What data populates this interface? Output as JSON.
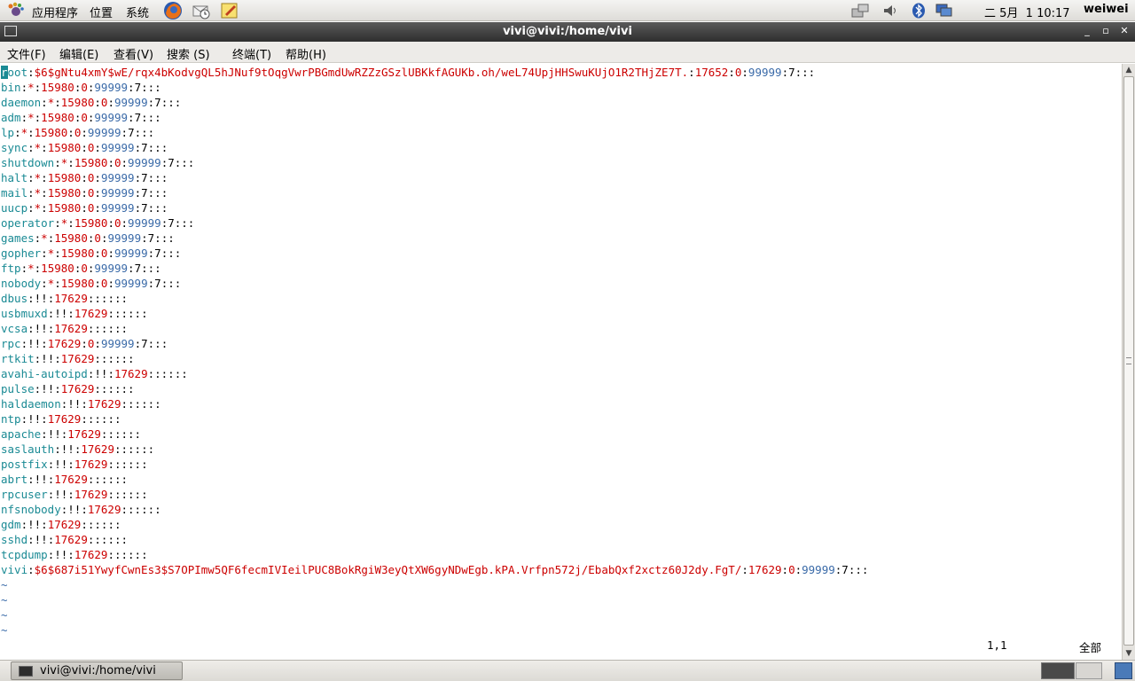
{
  "top_panel": {
    "menus": [
      "应用程序",
      "位置",
      "系统"
    ],
    "clock": "二 5月  1 10:17",
    "user": "weiwei"
  },
  "window": {
    "title": "vivi@vivi:/home/vivi"
  },
  "menubar": {
    "items": [
      "文件(F)",
      "编辑(E)",
      "查看(V)",
      "搜索 (S)",
      "终端(T)",
      "帮助(H)"
    ]
  },
  "terminal": {
    "lines": [
      {
        "user": "root",
        "passwd": "$6$gNtu4xmY$wE/rqx4bKodvgQL5hJNuf9tOqgVwrPBGmdUwRZZzGSzlUBKkfAGUKb.oh/weL74UpjHHSwuKUjO1R2THjZE7T.",
        "lastchg": "17652",
        "min": "0",
        "max": "99999",
        "warn": "7",
        "rest": ":::"
      },
      {
        "user": "bin",
        "passwd": "*",
        "lastchg": "15980",
        "min": "0",
        "max": "99999",
        "warn": "7",
        "rest": ":::"
      },
      {
        "user": "daemon",
        "passwd": "*",
        "lastchg": "15980",
        "min": "0",
        "max": "99999",
        "warn": "7",
        "rest": ":::"
      },
      {
        "user": "adm",
        "passwd": "*",
        "lastchg": "15980",
        "min": "0",
        "max": "99999",
        "warn": "7",
        "rest": ":::"
      },
      {
        "user": "lp",
        "passwd": "*",
        "lastchg": "15980",
        "min": "0",
        "max": "99999",
        "warn": "7",
        "rest": ":::"
      },
      {
        "user": "sync",
        "passwd": "*",
        "lastchg": "15980",
        "min": "0",
        "max": "99999",
        "warn": "7",
        "rest": ":::"
      },
      {
        "user": "shutdown",
        "passwd": "*",
        "lastchg": "15980",
        "min": "0",
        "max": "99999",
        "warn": "7",
        "rest": ":::"
      },
      {
        "user": "halt",
        "passwd": "*",
        "lastchg": "15980",
        "min": "0",
        "max": "99999",
        "warn": "7",
        "rest": ":::"
      },
      {
        "user": "mail",
        "passwd": "*",
        "lastchg": "15980",
        "min": "0",
        "max": "99999",
        "warn": "7",
        "rest": ":::"
      },
      {
        "user": "uucp",
        "passwd": "*",
        "lastchg": "15980",
        "min": "0",
        "max": "99999",
        "warn": "7",
        "rest": ":::"
      },
      {
        "user": "operator",
        "passwd": "*",
        "lastchg": "15980",
        "min": "0",
        "max": "99999",
        "warn": "7",
        "rest": ":::"
      },
      {
        "user": "games",
        "passwd": "*",
        "lastchg": "15980",
        "min": "0",
        "max": "99999",
        "warn": "7",
        "rest": ":::"
      },
      {
        "user": "gopher",
        "passwd": "*",
        "lastchg": "15980",
        "min": "0",
        "max": "99999",
        "warn": "7",
        "rest": ":::"
      },
      {
        "user": "ftp",
        "passwd": "*",
        "lastchg": "15980",
        "min": "0",
        "max": "99999",
        "warn": "7",
        "rest": ":::"
      },
      {
        "user": "nobody",
        "passwd": "*",
        "lastchg": "15980",
        "min": "0",
        "max": "99999",
        "warn": "7",
        "rest": ":::"
      },
      {
        "user": "dbus",
        "passwd": "!!",
        "lastchg": "17629",
        "rest": "::::::"
      },
      {
        "user": "usbmuxd",
        "passwd": "!!",
        "lastchg": "17629",
        "rest": "::::::"
      },
      {
        "user": "vcsa",
        "passwd": "!!",
        "lastchg": "17629",
        "rest": "::::::"
      },
      {
        "user": "rpc",
        "passwd": "!!",
        "lastchg": "17629",
        "min": "0",
        "max": "99999",
        "warn": "7",
        "rest": ":::"
      },
      {
        "user": "rtkit",
        "passwd": "!!",
        "lastchg": "17629",
        "rest": "::::::"
      },
      {
        "user": "avahi-autoipd",
        "passwd": "!!",
        "lastchg": "17629",
        "rest": "::::::"
      },
      {
        "user": "pulse",
        "passwd": "!!",
        "lastchg": "17629",
        "rest": "::::::"
      },
      {
        "user": "haldaemon",
        "passwd": "!!",
        "lastchg": "17629",
        "rest": "::::::"
      },
      {
        "user": "ntp",
        "passwd": "!!",
        "lastchg": "17629",
        "rest": "::::::"
      },
      {
        "user": "apache",
        "passwd": "!!",
        "lastchg": "17629",
        "rest": "::::::"
      },
      {
        "user": "saslauth",
        "passwd": "!!",
        "lastchg": "17629",
        "rest": "::::::"
      },
      {
        "user": "postfix",
        "passwd": "!!",
        "lastchg": "17629",
        "rest": "::::::"
      },
      {
        "user": "abrt",
        "passwd": "!!",
        "lastchg": "17629",
        "rest": "::::::"
      },
      {
        "user": "rpcuser",
        "passwd": "!!",
        "lastchg": "17629",
        "rest": "::::::"
      },
      {
        "user": "nfsnobody",
        "passwd": "!!",
        "lastchg": "17629",
        "rest": "::::::"
      },
      {
        "user": "gdm",
        "passwd": "!!",
        "lastchg": "17629",
        "rest": "::::::"
      },
      {
        "user": "sshd",
        "passwd": "!!",
        "lastchg": "17629",
        "rest": "::::::"
      },
      {
        "user": "tcpdump",
        "passwd": "!!",
        "lastchg": "17629",
        "rest": "::::::"
      },
      {
        "user": "vivi",
        "passwd": "$6$687i51YwyfCwnEs3$S7OPImw5QF6fecmIVIeilPUC8BokRgiW3eyQtXW6gyNDwEgb.kPA.Vrfpn572j/EbabQxf2xctz60J2dy.FgT/",
        "lastchg": "17629",
        "min": "0",
        "max": "99999",
        "warn": "7",
        "rest": ":::"
      }
    ],
    "tilde_lines": [
      "~",
      "~",
      "~",
      "~"
    ],
    "status_position": "1,1",
    "status_all": "全部"
  },
  "taskbar": {
    "task_label": "vivi@vivi:/home/vivi"
  },
  "colors": {
    "username": "#1a8a94",
    "password_hash": "#cc0000",
    "number": "#cc0000",
    "max_days": "#3a6aa8"
  }
}
